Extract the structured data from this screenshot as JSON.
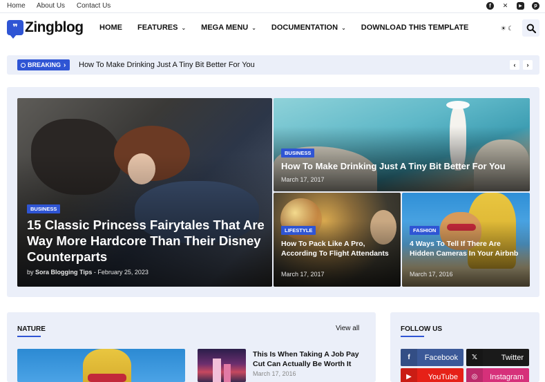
{
  "topbar": {
    "links": [
      "Home",
      "About Us",
      "Contact Us"
    ],
    "socials": [
      "facebook-icon",
      "x-icon",
      "youtube-icon",
      "pinterest-icon"
    ]
  },
  "header": {
    "logo_text": "Zingblog",
    "logo_glyph": "❞",
    "nav": [
      {
        "label": "HOME",
        "has_dropdown": false
      },
      {
        "label": "FEATURES",
        "has_dropdown": true
      },
      {
        "label": "MEGA MENU",
        "has_dropdown": true
      },
      {
        "label": "DOCUMENTATION",
        "has_dropdown": true
      },
      {
        "label": "DOWNLOAD THIS TEMPLATE",
        "has_dropdown": false
      }
    ],
    "theme_toggle_glyph": "☀ ☾"
  },
  "breaking": {
    "badge": "BREAKING",
    "chevron": "›",
    "headline": "How To Make Drinking Just A Tiny Bit Better For You",
    "prev": "‹",
    "next": "›"
  },
  "hero": {
    "main": {
      "tag": "BUSINESS",
      "title": "15 Classic Princess Fairytales That Are Way More Hardcore Than Their Disney Counterparts",
      "author": "Sora Blogging Tips",
      "byline_prefix": "by",
      "date": "February 25, 2023"
    },
    "top_right": {
      "tag": "BUSINESS",
      "title": "How To Make Drinking Just A Tiny Bit Better For You",
      "date": "March 17, 2017"
    },
    "bottom_left": {
      "tag": "LIFESTYLE",
      "title": "How To Pack Like A Pro, According To Flight Attendants",
      "date": "March 17, 2017"
    },
    "bottom_right": {
      "tag": "FASHION",
      "title": "4 Ways To Tell If There Are Hidden Cameras In Your Airbnb",
      "date": "March 17, 2016"
    }
  },
  "nature": {
    "title": "NATURE",
    "view_all": "View all",
    "post": {
      "title": "This Is When Taking A Job Pay Cut Can Actually Be Worth It",
      "date": "March 17, 2016"
    }
  },
  "follow": {
    "title": "FOLLOW US",
    "buttons": [
      {
        "label": "Facebook",
        "icon": "f",
        "color": "#3b5998"
      },
      {
        "label": "Twitter",
        "icon": "𝕏",
        "color": "#1a1a1a"
      },
      {
        "label": "YouTube",
        "icon": "▶",
        "color": "#e62117"
      },
      {
        "label": "Instagram",
        "icon": "◎",
        "color": "#d6307a"
      }
    ]
  },
  "colors": {
    "accent": "#2f55d4",
    "panel": "#ebeff9"
  }
}
